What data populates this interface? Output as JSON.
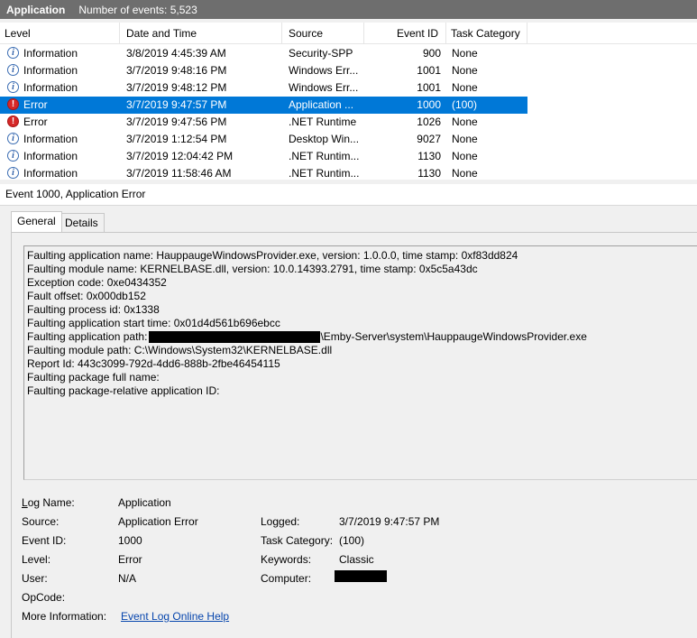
{
  "titlebar": {
    "title": "Application",
    "subtitle": "Number of events: 5,523"
  },
  "columns": [
    "Level",
    "Date and Time",
    "Source",
    "Event ID",
    "Task Category"
  ],
  "events": [
    {
      "level": "Information",
      "icon": "info-icon",
      "datetime": "3/8/2019 4:45:39 AM",
      "source": "Security-SPP",
      "event_id": "900",
      "category": "None"
    },
    {
      "level": "Information",
      "icon": "info-icon",
      "datetime": "3/7/2019 9:48:16 PM",
      "source": "Windows Err...",
      "event_id": "1001",
      "category": "None"
    },
    {
      "level": "Information",
      "icon": "info-icon",
      "datetime": "3/7/2019 9:48:12 PM",
      "source": "Windows Err...",
      "event_id": "1001",
      "category": "None"
    },
    {
      "level": "Error",
      "icon": "error-icon",
      "datetime": "3/7/2019 9:47:57 PM",
      "source": "Application ...",
      "event_id": "1000",
      "category": "(100)"
    },
    {
      "level": "Error",
      "icon": "error-icon",
      "datetime": "3/7/2019 9:47:56 PM",
      "source": ".NET Runtime",
      "event_id": "1026",
      "category": "None"
    },
    {
      "level": "Information",
      "icon": "info-icon",
      "datetime": "3/7/2019 1:12:54 PM",
      "source": "Desktop Win...",
      "event_id": "9027",
      "category": "None"
    },
    {
      "level": "Information",
      "icon": "info-icon",
      "datetime": "3/7/2019 12:04:42 PM",
      "source": ".NET Runtim...",
      "event_id": "1130",
      "category": "None"
    },
    {
      "level": "Information",
      "icon": "info-icon",
      "datetime": "3/7/2019 11:58:46 AM",
      "source": ".NET Runtim...",
      "event_id": "1130",
      "category": "None"
    }
  ],
  "selected_index": 3,
  "event_title": "Event 1000, Application Error",
  "tabs": [
    "General",
    "Details"
  ],
  "description": [
    "Faulting application name: HauppaugeWindowsProvider.exe, version: 1.0.0.0, time stamp: 0xf83dd824",
    "Faulting module name: KERNELBASE.dll, version: 10.0.14393.2791, time stamp: 0x5c5a43dc",
    "Exception code: 0xe0434352",
    "Fault offset: 0x000db152",
    "Faulting process id: 0x1338",
    "Faulting application start time: 0x01d4d561b696ebcc"
  ],
  "app_path_label": "Faulting application path:",
  "app_path_value": "\\Emby-Server\\system\\HauppaugeWindowsProvider.exe",
  "description_tail": [
    "Faulting module path: C:\\Windows\\System32\\KERNELBASE.dll",
    "Report Id: 443c3099-792d-4dd6-888b-2fbe46454115",
    "Faulting package full name:",
    "Faulting package-relative application ID:"
  ],
  "details": {
    "log_name_label": "Log Name:",
    "log_name": "Application",
    "source_label": "Source:",
    "source": "Application Error",
    "logged_label": "Logged:",
    "logged": "3/7/2019 9:47:57 PM",
    "event_id_label": "Event ID:",
    "event_id": "1000",
    "task_category_label": "Task Category:",
    "task_category": "(100)",
    "level_label": "Level:",
    "level": "Error",
    "keywords_label": "Keywords:",
    "keywords": "Classic",
    "user_label": "User:",
    "user": "N/A",
    "computer_label": "Computer:",
    "opcode_label": "OpCode:",
    "more_info_label": "More Information:",
    "more_info_link": "Event Log Online Help"
  },
  "colors": {
    "selection": "#0078d7",
    "titlebar": "#6e6e6e",
    "link": "#0645ad",
    "error": "#d62828",
    "info": "#3b6db3"
  }
}
